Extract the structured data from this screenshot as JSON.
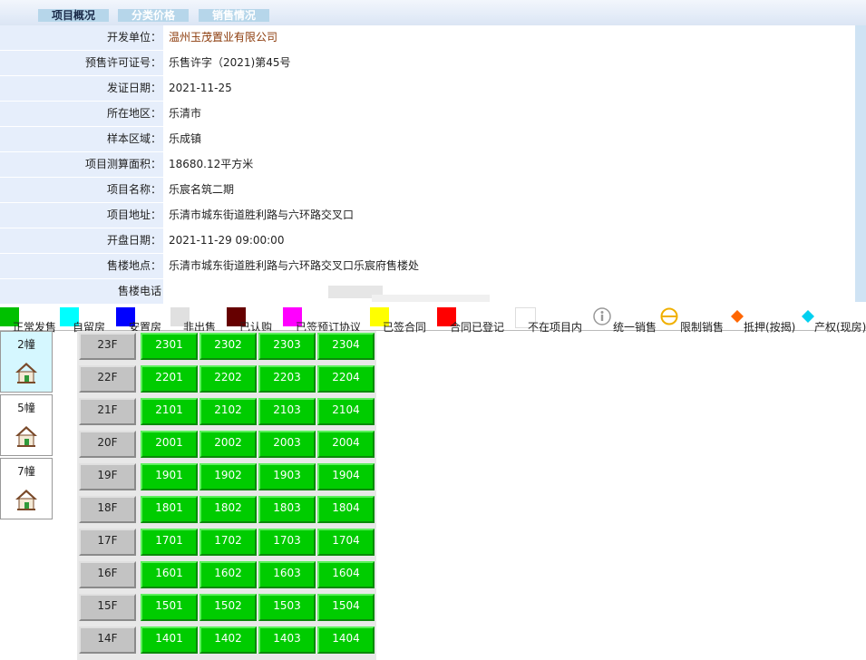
{
  "tabs": [
    "项目概况",
    "分类价格",
    "销售情况"
  ],
  "info": [
    {
      "label": "开发单位：",
      "value": "温州玉茂置业有限公司",
      "style": "brown"
    },
    {
      "label": "预售许可证号：",
      "value": "乐售许字（2021)第45号"
    },
    {
      "label": "发证日期：",
      "value": "2021-11-25"
    },
    {
      "label": "所在地区：",
      "value": "乐清市"
    },
    {
      "label": "样本区域：",
      "value": "乐成镇"
    },
    {
      "label": "项目测算面积：",
      "value": "18680.12平方米"
    },
    {
      "label": "项目名称：",
      "value": "乐宸名筑二期"
    },
    {
      "label": "项目地址：",
      "value": "乐清市城东街道胜利路与六环路交叉口"
    },
    {
      "label": "开盘日期：",
      "value": "2021-11-29 09:00:00"
    },
    {
      "label": "售楼地点：",
      "value": "乐清市城东街道胜利路与六环路交叉口乐宸府售楼处"
    },
    {
      "label": "售楼电话",
      "value": ""
    }
  ],
  "legend": [
    {
      "label": "正常发售",
      "color": "#00c000",
      "kind": "swatch"
    },
    {
      "label": "自留房",
      "color": "#00ffff",
      "kind": "swatch"
    },
    {
      "label": "安置房",
      "color": "#0000ff",
      "kind": "swatch"
    },
    {
      "label": "非出售",
      "color": "#e0e0e0",
      "kind": "swatch"
    },
    {
      "label": "已认购",
      "color": "#660000",
      "kind": "swatch"
    },
    {
      "label": "已签预订协议",
      "color": "#ff00ff",
      "kind": "swatch"
    },
    {
      "label": "已签合同",
      "color": "#ffff00",
      "kind": "swatch"
    },
    {
      "label": "合同已登记",
      "color": "#ff0000",
      "kind": "swatch"
    },
    {
      "label": "不在项目内",
      "color": "#ffffff",
      "kind": "swatch"
    },
    {
      "label": "统一销售",
      "color": "#999999",
      "kind": "info-icon"
    },
    {
      "label": "限制销售",
      "color": "#f0b000",
      "kind": "limit-icon"
    },
    {
      "label": "抵押(按揭)",
      "color": "#ff6600",
      "kind": "diamond"
    },
    {
      "label": "产权(现房)",
      "color": "#00d0f0",
      "kind": "diamond"
    }
  ],
  "buildings": [
    {
      "name": "2幢",
      "selected": true
    },
    {
      "name": "5幢",
      "selected": false
    },
    {
      "name": "7幢",
      "selected": false
    }
  ],
  "floors": [
    {
      "floor": "23F",
      "units": [
        "2301",
        "2302",
        "2303",
        "2304"
      ]
    },
    {
      "floor": "22F",
      "units": [
        "2201",
        "2202",
        "2203",
        "2204"
      ]
    },
    {
      "floor": "21F",
      "units": [
        "2101",
        "2102",
        "2103",
        "2104"
      ]
    },
    {
      "floor": "20F",
      "units": [
        "2001",
        "2002",
        "2003",
        "2004"
      ]
    },
    {
      "floor": "19F",
      "units": [
        "1901",
        "1902",
        "1903",
        "1904"
      ]
    },
    {
      "floor": "18F",
      "units": [
        "1801",
        "1802",
        "1803",
        "1804"
      ]
    },
    {
      "floor": "17F",
      "units": [
        "1701",
        "1702",
        "1703",
        "1704"
      ]
    },
    {
      "floor": "16F",
      "units": [
        "1601",
        "1602",
        "1603",
        "1604"
      ]
    },
    {
      "floor": "15F",
      "units": [
        "1501",
        "1502",
        "1503",
        "1504"
      ]
    },
    {
      "floor": "14F",
      "units": [
        "1401",
        "1402",
        "1403",
        "1404"
      ]
    }
  ]
}
